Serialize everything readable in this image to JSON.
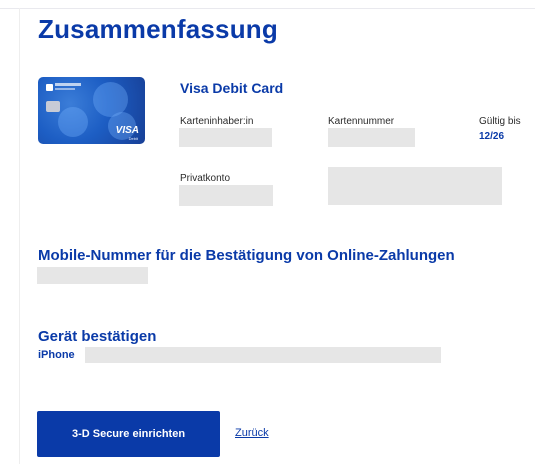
{
  "page": {
    "title": "Zusammenfassung"
  },
  "card": {
    "brand": "VISA",
    "brand_sub": "Debit",
    "title": "Visa Debit Card",
    "holder_label": "Karteninhaber:in",
    "number_label": "Kartennummer",
    "valid_label": "Gültig bis",
    "valid_value": "12/26",
    "account_label": "Privatkonto"
  },
  "mobile": {
    "title": "Mobile-Nummer für die Bestätigung von Online-Zahlungen"
  },
  "device": {
    "title": "Gerät bestätigen",
    "name": "iPhone"
  },
  "actions": {
    "primary_label": "3-D Secure einrichten",
    "back_label": "Zurück"
  },
  "colors": {
    "accent": "#0a3aa8",
    "redaction": "#e6e6e6"
  }
}
